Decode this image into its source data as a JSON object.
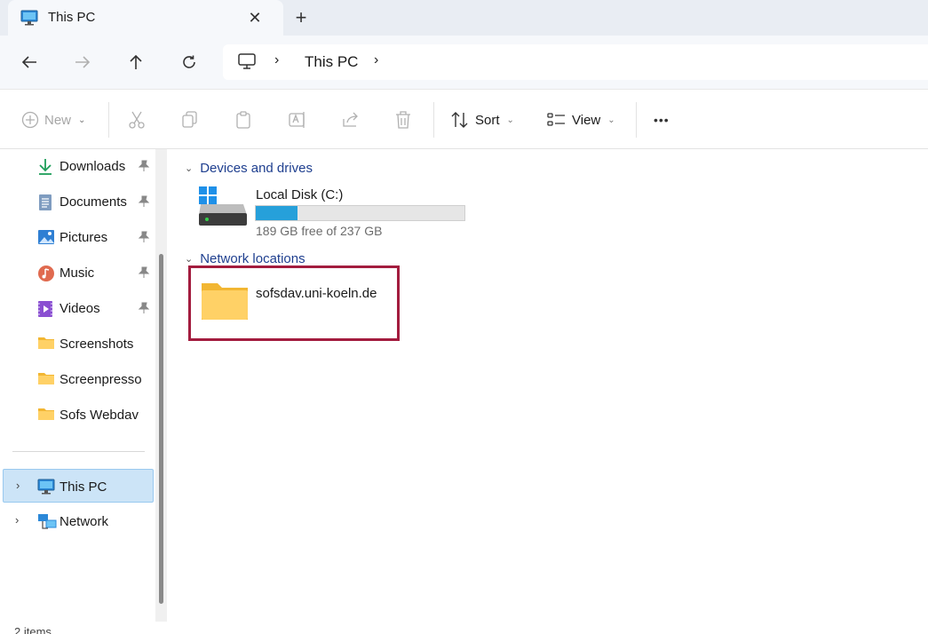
{
  "tab": {
    "title": "This PC",
    "close": "✕",
    "new_tab": "+"
  },
  "address": {
    "location": "This PC",
    "separator": "›"
  },
  "toolbar": {
    "new_label": "New",
    "sort_label": "Sort",
    "view_label": "View",
    "more_label": "•••",
    "caret": "⌄"
  },
  "sidebar": {
    "quick_access": [
      {
        "label": "Downloads",
        "icon": "download-icon",
        "pinned": true
      },
      {
        "label": "Documents",
        "icon": "documents-icon",
        "pinned": true
      },
      {
        "label": "Pictures",
        "icon": "pictures-icon",
        "pinned": true
      },
      {
        "label": "Music",
        "icon": "music-icon",
        "pinned": true
      },
      {
        "label": "Videos",
        "icon": "videos-icon",
        "pinned": true
      },
      {
        "label": "Screenshots",
        "icon": "folder-icon",
        "pinned": false
      },
      {
        "label": "Screenpresso",
        "icon": "folder-icon",
        "pinned": false
      },
      {
        "label": "Sofs Webdav",
        "icon": "folder-icon",
        "pinned": false
      }
    ],
    "tree": [
      {
        "label": "This PC",
        "icon": "monitor-icon",
        "selected": true
      },
      {
        "label": "Network",
        "icon": "network-icon",
        "selected": false
      }
    ],
    "expand_chevron": "›"
  },
  "main": {
    "devices_header": "Devices and drives",
    "drive": {
      "name": "Local Disk (C:)",
      "free_text": "189 GB free of 237 GB",
      "used_fraction": 0.2
    },
    "network_header": "Network locations",
    "network_location": {
      "name": "sofsdav.uni-koeln.de"
    },
    "group_chevron": "⌄"
  },
  "status": {
    "text": "2 items"
  },
  "colors": {
    "accent": "#26a0da",
    "highlight_border": "#a31c3e",
    "selection": "#cce4f7",
    "header_text": "#1f3f8f"
  }
}
